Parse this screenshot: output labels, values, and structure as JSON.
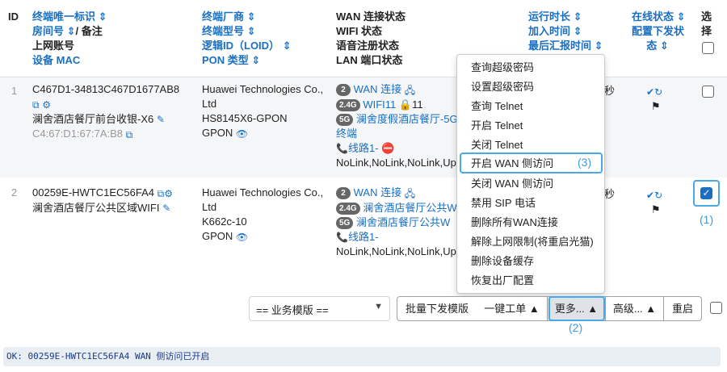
{
  "header": {
    "id": "ID",
    "col1": [
      "终端唯一标识 ⇕",
      "房间号 ⇕",
      "/ 备注",
      "上网账号",
      "设备 MAC"
    ],
    "col2": [
      "终端厂商 ⇕",
      "终端型号 ⇕",
      "逻辑ID（LOID） ⇕",
      "PON 类型 ⇕"
    ],
    "col3": [
      "WAN 连接状态",
      "WIFI 状态",
      "语音注册状态",
      "LAN 端口状态"
    ],
    "col4": [
      "运行时长 ⇕",
      "加入时间 ⇕",
      "最后汇报时间 ⇕"
    ],
    "col5": [
      "在线状态 ⇕",
      "配置下发状",
      "态 ⇕"
    ],
    "col6": [
      "选",
      "择"
    ]
  },
  "rows": [
    {
      "id": "1",
      "device_id": "C467D1-34813C467D1677AB8",
      "room": "澜舍酒店餐厅前台收银-X6",
      "mac": "C4:67:D1:67:7A:B8",
      "vendor": [
        "Huawei Technologies Co.,",
        "Ltd"
      ],
      "model": "HS8145X6-GPON",
      "pon": "GPON",
      "wan_count": "2",
      "wan_label": "WAN 连接",
      "wifi_band1": "2.4G",
      "wifi_name1": "WIFI11",
      "wifi_extra1": "11",
      "wifi_band2": "5G",
      "wifi_name2": "澜舍度假酒店餐厅-5G",
      "wifi_cont": "终端",
      "voice": "线路1-",
      "lan": "NoLink,NoLink,NoLink,Up",
      "runtime_tail": "秒",
      "checked": false
    },
    {
      "id": "2",
      "device_id": "00259E-HWTC1EC56FA4",
      "room": "澜舍酒店餐厅公共区域WIFI",
      "vendor": [
        "Huawei Technologies Co.,",
        "Ltd"
      ],
      "model": "K662c-10",
      "pon": "GPON",
      "wan_count": "2",
      "wan_label": "WAN 连接",
      "wifi_band1": "2.4G",
      "wifi_name1": "澜舍酒店餐厅公共W",
      "wifi_band2": "5G",
      "wifi_name2": "澜舍酒店餐厅公共W",
      "voice": "线路1-",
      "lan": "NoLink,NoLink,NoLink,Up",
      "runtime_tail": "秒",
      "checked": true
    }
  ],
  "menu": [
    "查询超级密码",
    "设置超级密码",
    "查询 Telnet",
    "开启 Telnet",
    "关闭 Telnet",
    "开启 WAN 侧访问",
    "关闭 WAN 侧访问",
    "禁用 SIP 电话",
    "删除所有WAN连接",
    "解除上网限制(将重启光猫)",
    "删除设备缓存",
    "恢复出厂配置"
  ],
  "annotations": {
    "n1": "(1)",
    "n2": "(2)",
    "n3": "(3)"
  },
  "toolbar": {
    "template_select": "== 业务模版 ==",
    "batch_button": "批量下发模版",
    "onekey_button": "一键工单 ▲",
    "more_button": "更多... ▲",
    "advanced_button": "高级... ▲",
    "restart_button": "重启"
  },
  "status": "OK: 00259E-HWTC1EC56FA4 WAN 侧访问已开启",
  "colors": {
    "link": "#1a6fc2",
    "highlight": "#4aa8e6",
    "status_bg": "#e9eef3"
  }
}
